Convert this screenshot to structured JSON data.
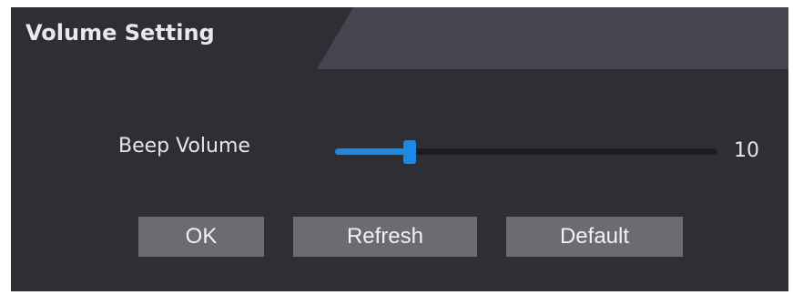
{
  "panel": {
    "title": "Volume Setting"
  },
  "beep_volume": {
    "label": "Beep Volume",
    "value": "10",
    "min": 0,
    "max": 100,
    "level": 10
  },
  "buttons": {
    "ok_label": "OK",
    "refresh_label": "Refresh",
    "default_label": "Default"
  },
  "colors": {
    "accent": "#1e88e5",
    "panel_bg": "#2e2e35",
    "button_bg": "#6b6b72"
  }
}
